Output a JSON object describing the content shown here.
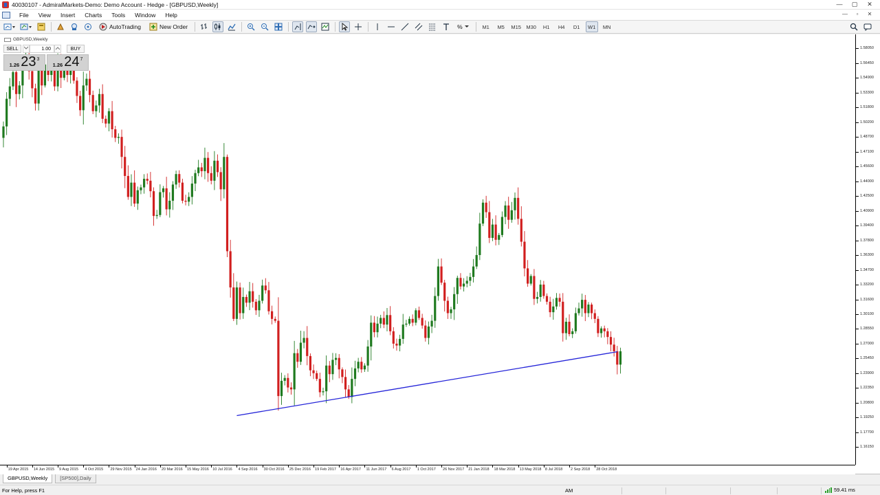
{
  "window": {
    "title": "40030107 - AdmiralMarkets-Demo: Demo Account - Hedge - [GBPUSD,Weekly]",
    "controls": [
      "—",
      "▢",
      "✕"
    ]
  },
  "menubar": {
    "items": [
      "File",
      "View",
      "Insert",
      "Charts",
      "Tools",
      "Window",
      "Help"
    ],
    "mdi_controls": [
      "—",
      "▫",
      "✕"
    ]
  },
  "toolbar": {
    "autotrading_label": "AutoTrading",
    "new_order_label": "New Order",
    "timeframes": [
      "M1",
      "M5",
      "M15",
      "M30",
      "H1",
      "H4",
      "D1",
      "W1",
      "MN"
    ],
    "active_timeframe": "W1",
    "percent_label": "%"
  },
  "chart": {
    "symbol_label": "GBPUSD,Weekly",
    "one_click": {
      "sell_label": "SELL",
      "buy_label": "BUY",
      "volume": "1.00",
      "sell_price_prefix": "1.26",
      "sell_price_big": "23",
      "sell_price_sup": "3",
      "buy_price_prefix": "1.26",
      "buy_price_big": "24",
      "buy_price_sup": "7"
    },
    "colors": {
      "bull": "#1f7a1f",
      "bear": "#d11f1f",
      "trendline": "#2323d8",
      "background": "#ffffff"
    }
  },
  "chart_data": {
    "type": "candlestick",
    "symbol": "GBPUSD",
    "timeframe": "Weekly",
    "ylim": [
      1.1429,
      1.5946
    ],
    "price_ticks": [
      "1.59550",
      "1.58050",
      "1.56450",
      "1.54900",
      "1.53300",
      "1.51800",
      "1.50200",
      "1.48700",
      "1.47100",
      "1.45600",
      "1.44000",
      "1.42500",
      "1.40900",
      "1.39400",
      "1.37800",
      "1.36300",
      "1.34700",
      "1.33200",
      "1.31600",
      "1.30100",
      "1.28550",
      "1.27000",
      "1.25450",
      "1.23900",
      "1.22350",
      "1.20800",
      "1.19250",
      "1.17700",
      "1.16150"
    ],
    "time_ticks": [
      "19 Apr 2015",
      "14 Jun 2015",
      "9 Aug 2015",
      "4 Oct 2015",
      "29 Nov 2015",
      "24 Jan 2016",
      "20 Mar 2016",
      "15 May 2016",
      "10 Jul 2016",
      "4 Sep 2016",
      "30 Oct 2016",
      "25 Dec 2016",
      "19 Feb 2017",
      "16 Apr 2017",
      "11 Jun 2017",
      "6 Aug 2017",
      "1 Oct 2017",
      "26 Nov 2017",
      "21 Jan 2018",
      "18 Mar 2018",
      "13 May 2018",
      "8 Jul 2018",
      "2 Sep 2018",
      "28 Oct 2018"
    ],
    "closes": [
      1.498,
      1.527,
      1.54,
      1.555,
      1.532,
      1.541,
      1.563,
      1.57,
      1.556,
      1.538,
      1.522,
      1.559,
      1.541,
      1.563,
      1.552,
      1.557,
      1.54,
      1.569,
      1.549,
      1.557,
      1.552,
      1.564,
      1.546,
      1.53,
      1.515,
      1.541,
      1.548,
      1.531,
      1.514,
      1.52,
      1.532,
      1.506,
      1.501,
      1.514,
      1.495,
      1.486,
      1.487,
      1.466,
      1.446,
      1.424,
      1.439,
      1.417,
      1.431,
      1.434,
      1.443,
      1.441,
      1.43,
      1.404,
      1.405,
      1.429,
      1.433,
      1.411,
      1.42,
      1.437,
      1.448,
      1.439,
      1.42,
      1.419,
      1.424,
      1.438,
      1.449,
      1.455,
      1.451,
      1.465,
      1.449,
      1.441,
      1.462,
      1.45,
      1.432,
      1.466,
      1.367,
      1.329,
      1.296,
      1.329,
      1.302,
      1.319,
      1.313,
      1.325,
      1.314,
      1.305,
      1.315,
      1.331,
      1.326,
      1.304,
      1.296,
      1.294,
      1.215,
      1.231,
      1.234,
      1.224,
      1.222,
      1.26,
      1.251,
      1.271,
      1.276,
      1.257,
      1.242,
      1.239,
      1.233,
      1.219,
      1.22,
      1.247,
      1.238,
      1.253,
      1.255,
      1.243,
      1.235,
      1.222,
      1.214,
      1.233,
      1.244,
      1.251,
      1.243,
      1.247,
      1.267,
      1.292,
      1.282,
      1.291,
      1.297,
      1.29,
      1.3,
      1.283,
      1.27,
      1.268,
      1.275,
      1.29,
      1.291,
      1.296,
      1.292,
      1.305,
      1.297,
      1.289,
      1.276,
      1.288,
      1.294,
      1.32,
      1.351,
      1.334,
      1.315,
      1.302,
      1.306,
      1.322,
      1.339,
      1.33,
      1.333,
      1.336,
      1.34,
      1.351,
      1.363,
      1.396,
      1.418,
      1.408,
      1.381,
      1.395,
      1.379,
      1.384,
      1.403,
      1.415,
      1.4,
      1.41,
      1.423,
      1.401,
      1.377,
      1.349,
      1.333,
      1.341,
      1.317,
      1.319,
      1.332,
      1.32,
      1.314,
      1.303,
      1.309,
      1.318,
      1.314,
      1.281,
      1.293,
      1.28,
      1.283,
      1.302,
      1.307,
      1.316,
      1.302,
      1.311,
      1.302,
      1.296,
      1.281,
      1.286,
      1.283,
      1.277,
      1.269,
      1.262,
      1.248,
      1.262
    ],
    "trendline": [
      [
        "4 Sep 2016",
        1.1945
      ],
      [
        "2018-12-16",
        1.2615
      ]
    ]
  },
  "tabs": [
    "GBPUSD,Weekly",
    "[SP500],Daily"
  ],
  "active_tab": 0,
  "statusbar": {
    "help": "For Help, press F1",
    "ampm": "AM",
    "connection": "59.41 ms"
  }
}
